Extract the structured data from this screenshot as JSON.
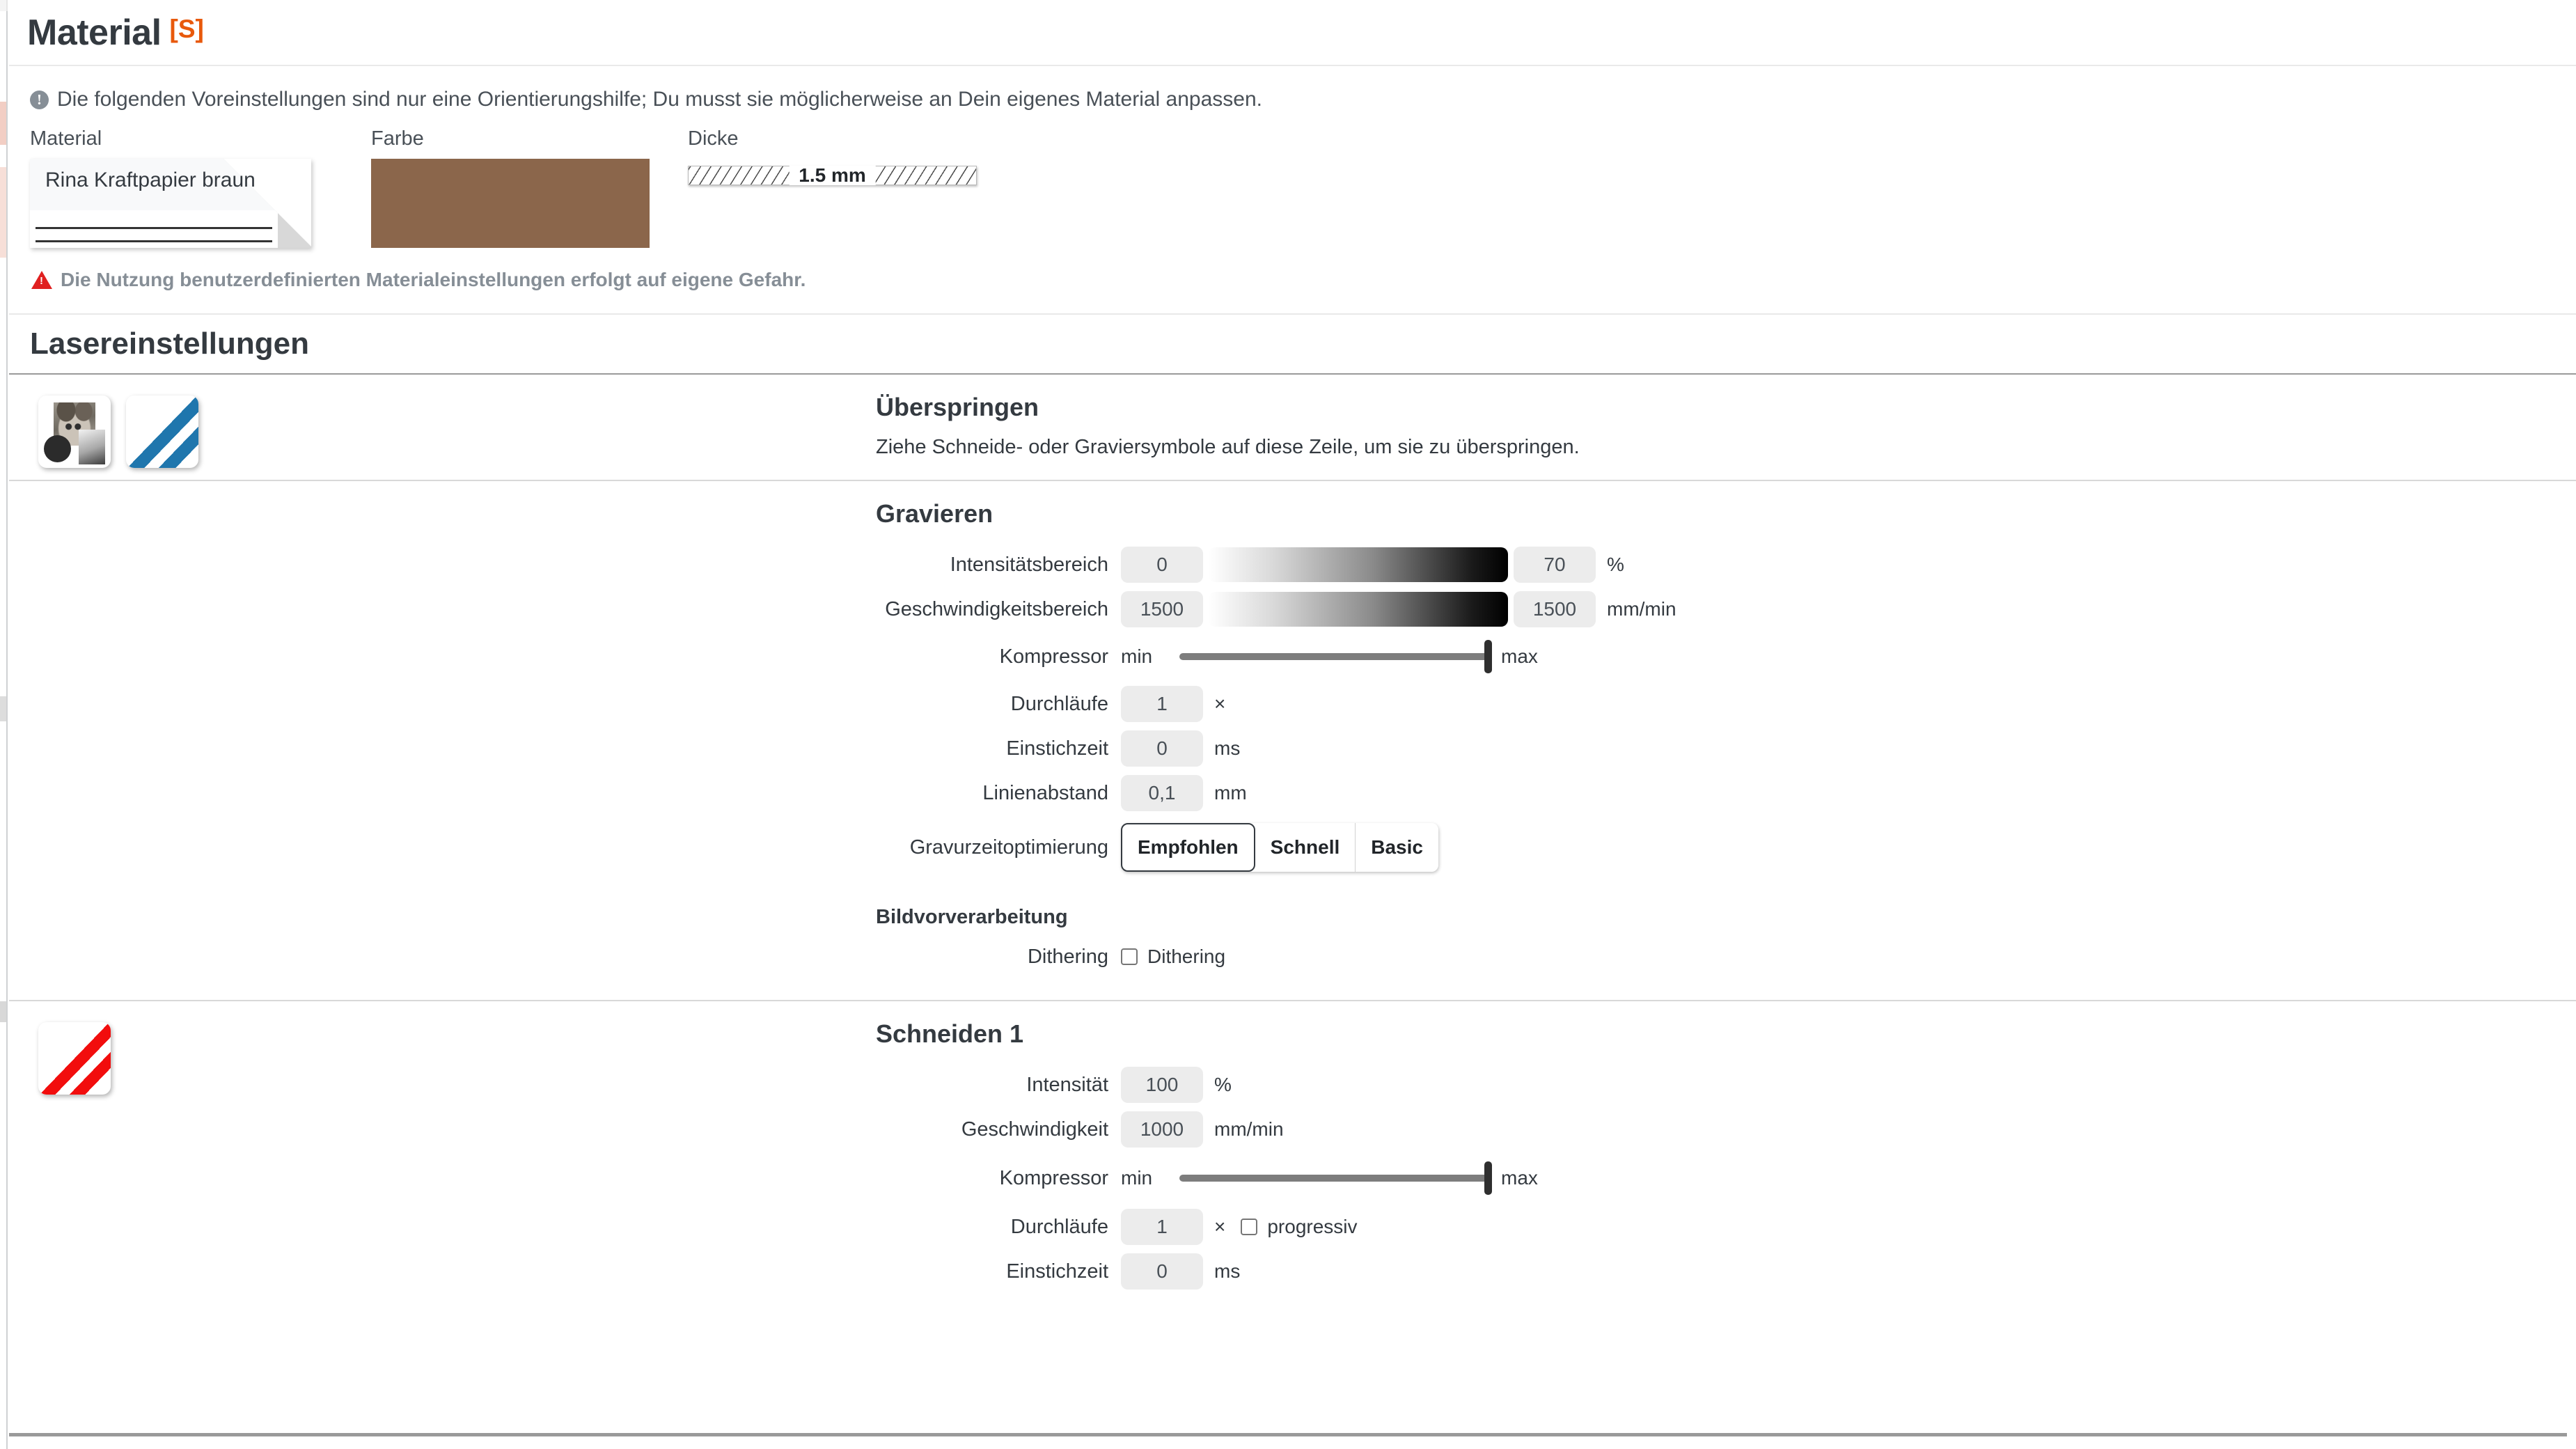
{
  "material_panel": {
    "title": "Material",
    "title_badge": "[S]",
    "info_notice": "Die folgenden Voreinstellungen sind nur eine Orientierungshilfe; Du musst sie möglicherweise an Dein eigenes Material anpassen.",
    "info_icon": "info-icon",
    "fields": {
      "material_label": "Material",
      "material_value": "Rina Kraftpapier braun",
      "color_label": "Farbe",
      "color_value": "#8b664b",
      "thickness_label": "Dicke",
      "thickness_value": "1.5 mm"
    },
    "risk_warning": "Die Nutzung benutzerdefinierten Materialeinstellungen erfolgt auf eigene Gefahr.",
    "risk_icon": "warning-triangle-icon",
    "risk_color": "#e02020"
  },
  "laser_settings": {
    "title": "Lasereinstellungen",
    "skip_section": {
      "thumbnails": [
        "engrave-thumbnail",
        "blue-lines-thumbnail"
      ],
      "heading": "Überspringen",
      "description": "Ziehe Schneide- oder Graviersymbole auf diese Zeile, um sie zu überspringen."
    },
    "engrave_section": {
      "heading": "Gravieren",
      "rows": {
        "intensity_range": {
          "label": "Intensitätsbereich",
          "min": "0",
          "max": "70",
          "unit": "%"
        },
        "speed_range": {
          "label": "Geschwindigkeitsbereich",
          "min": "1500",
          "max": "1500",
          "unit": "mm/min"
        },
        "compressor": {
          "label": "Kompressor",
          "min_label": "min",
          "max_label": "max",
          "position_percent": 100
        },
        "passes": {
          "label": "Durchläufe",
          "value": "1",
          "unit": "×"
        },
        "pierce_time": {
          "label": "Einstichzeit",
          "value": "0",
          "unit": "ms"
        },
        "line_spacing": {
          "label": "Linienabstand",
          "value": "0,1",
          "unit": "mm"
        },
        "engrave_optimization": {
          "label": "Gravurzeitoptimierung",
          "options": [
            "Empfohlen",
            "Schnell",
            "Basic"
          ],
          "selected": "Empfohlen"
        }
      },
      "image_preprocessing": {
        "heading": "Bildvorverarbeitung",
        "dithering_label": "Dithering",
        "dithering_checkbox_label": "Dithering",
        "dithering_checked": false
      }
    },
    "cut_section": {
      "thumbnail": "red-lines-thumbnail",
      "heading": "Schneiden 1",
      "rows": {
        "intensity": {
          "label": "Intensität",
          "value": "100",
          "unit": "%"
        },
        "speed": {
          "label": "Geschwindigkeit",
          "value": "1000",
          "unit": "mm/min"
        },
        "compressor": {
          "label": "Kompressor",
          "min_label": "min",
          "max_label": "max",
          "position_percent": 100
        },
        "passes": {
          "label": "Durchläufe",
          "value": "1",
          "unit": "×",
          "progressive_label": "progressiv",
          "progressive_checked": false
        },
        "pierce_time": {
          "label": "Einstichzeit",
          "value": "0",
          "unit": "ms"
        }
      }
    }
  }
}
